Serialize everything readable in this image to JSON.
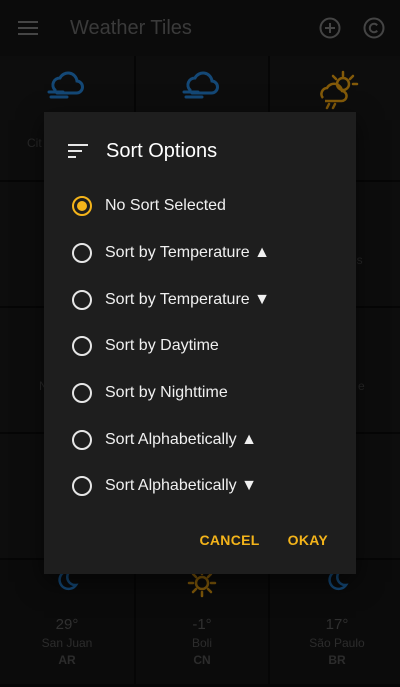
{
  "appbar": {
    "title": "Weather Tiles",
    "menu_icon": "menu-icon",
    "add_icon": "add-circle-icon",
    "copyright_icon": "copyright-icon"
  },
  "background_tiles": {
    "fragments": [
      "Cit",
      "es",
      "N",
      "e"
    ],
    "bottom": [
      {
        "temp": "29°",
        "city": "San Juan",
        "country": "AR",
        "icon": "moon-icon"
      },
      {
        "temp": "-1°",
        "city": "Boli",
        "country": "CN",
        "icon": "sun-icon"
      },
      {
        "temp": "17°",
        "city": "São Paulo",
        "country": "BR",
        "icon": "moon-icon"
      }
    ]
  },
  "dialog": {
    "title": "Sort Options",
    "icon": "sort-icon",
    "options": [
      {
        "label": "No Sort Selected",
        "checked": true
      },
      {
        "label": "Sort by Temperature ▲",
        "checked": false
      },
      {
        "label": "Sort by Temperature ▼",
        "checked": false
      },
      {
        "label": "Sort by Daytime",
        "checked": false
      },
      {
        "label": "Sort by Nighttime",
        "checked": false
      },
      {
        "label": "Sort Alphabetically ▲",
        "checked": false
      },
      {
        "label": "Sort Alphabetically ▼",
        "checked": false
      }
    ],
    "cancel_label": "CANCEL",
    "okay_label": "OKAY"
  },
  "colors": {
    "accent": "#f4b41a",
    "cloud_blue": "#1f6fb5",
    "sun_orange": "#c98a0f",
    "dialog_bg": "#1e1e1e"
  }
}
